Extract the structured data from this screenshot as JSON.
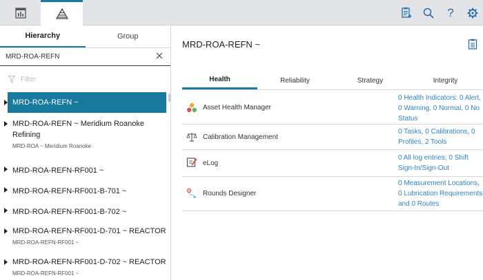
{
  "topbar": {
    "tabs": [
      {
        "icon": "dashboard-icon"
      },
      {
        "icon": "hierarchy-icon"
      }
    ],
    "actions": [
      {
        "icon": "new-clipboard-icon"
      },
      {
        "icon": "search-icon"
      },
      {
        "icon": "help-icon",
        "glyph": "?"
      },
      {
        "icon": "gear-icon"
      }
    ],
    "accent_color": "#1a7aa3"
  },
  "left_panel": {
    "tabs": [
      {
        "label": "Hierarchy",
        "active": true
      },
      {
        "label": "Group",
        "active": false
      }
    ],
    "search": {
      "value": "MRD-ROA-REFN"
    },
    "filter": {
      "placeholder": "Filter"
    },
    "items": [
      {
        "name": "MRD-ROA-REFN ~",
        "sub": "",
        "selected": true
      },
      {
        "name": "MRD-ROA-REFN ~ Meridium Roanoke Refining",
        "sub": "MRD-ROA ~ Meridium Roanoke"
      },
      {
        "name": "MRD-ROA-REFN-RF001 ~",
        "sub": ""
      },
      {
        "name": "MRD-ROA-REFN-RF001-B-701 ~",
        "sub": ""
      },
      {
        "name": "MRD-ROA-REFN-RF001-B-702 ~",
        "sub": ""
      },
      {
        "name": "MRD-ROA-REFN-RF001-D-701 ~ REACTOR",
        "sub": "MRD-ROA-REFN-RF001 ~"
      },
      {
        "name": "MRD-ROA-REFN-RF001-D-702 ~ REACTOR",
        "sub": "MRD-ROA-REFN-RF001 ~"
      }
    ],
    "selected_color": "#177a9c"
  },
  "right_panel": {
    "title": "MRD-ROA-REFN ~",
    "tabs": [
      {
        "label": "Health",
        "active": true
      },
      {
        "label": "Reliability",
        "active": false
      },
      {
        "label": "Strategy",
        "active": false
      },
      {
        "label": "Integrity",
        "active": false
      }
    ],
    "rows": [
      {
        "icon": "asset-health-icon",
        "label": "Asset Health Manager",
        "value": "0 Health Indicators: 0 Alert, 0 Warning, 0 Normal, 0 No Status"
      },
      {
        "icon": "calibration-scale-icon",
        "label": "Calibration Management",
        "value": "0 Tasks, 0 Calibrations, 0 Profiles, 2 Tools"
      },
      {
        "icon": "elog-pencil-icon",
        "label": "eLog",
        "value": "0 All log entries, 0 Shift Sign-In/Sign-Out"
      },
      {
        "icon": "rounds-route-icon",
        "label": "Rounds Designer",
        "value": "0 Measurement Locations, 0 Lubrication Requirements and 0 Routes"
      }
    ],
    "link_color": "#2e84c7"
  }
}
